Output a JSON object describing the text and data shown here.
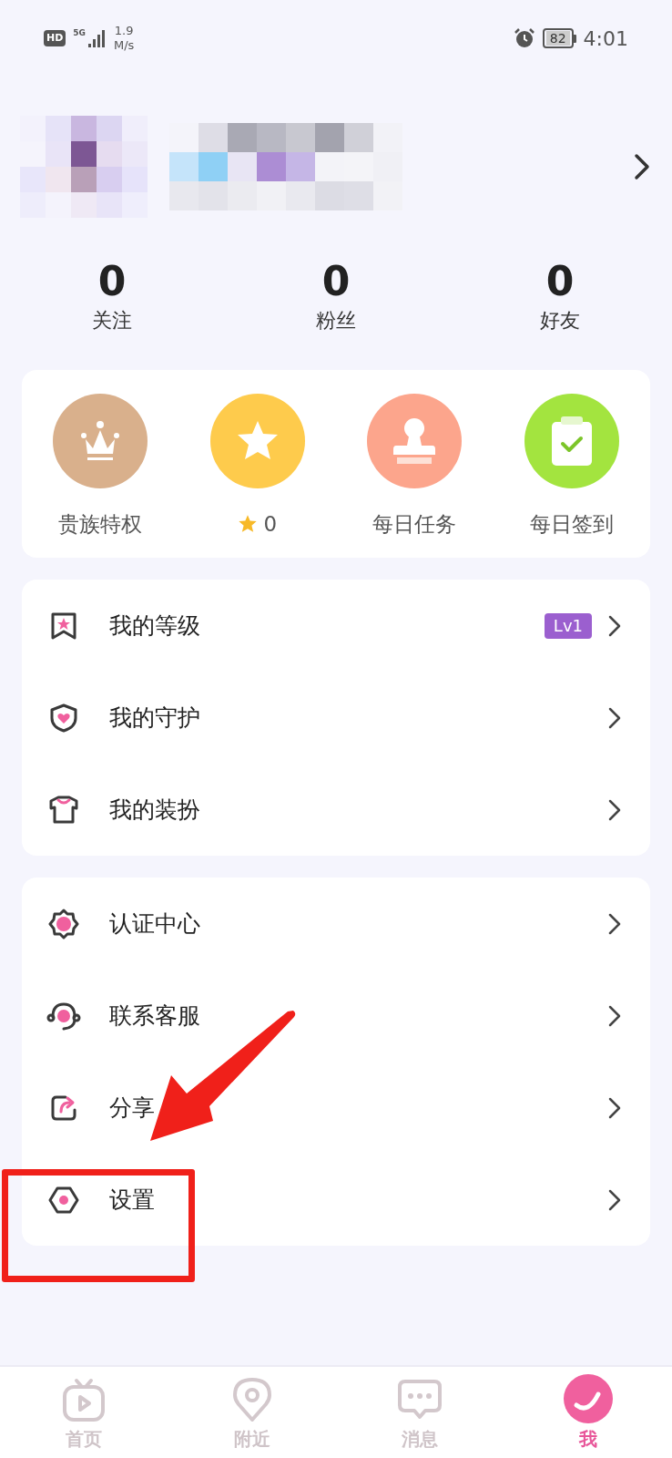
{
  "status_bar": {
    "hd": "HD",
    "network": "5G",
    "speed_value": "1.9",
    "speed_unit": "M/s",
    "battery": "82",
    "time": "4:01"
  },
  "stats": [
    {
      "value": "0",
      "label": "关注"
    },
    {
      "value": "0",
      "label": "粉丝"
    },
    {
      "value": "0",
      "label": "好友"
    }
  ],
  "quick_actions": [
    {
      "kind": "crown",
      "label": "贵族特权",
      "color": "#d9b08c"
    },
    {
      "kind": "star",
      "label": "0",
      "color": "#fecb4c"
    },
    {
      "kind": "stamp",
      "label": "每日任务",
      "color": "#fca58c"
    },
    {
      "kind": "clipboard",
      "label": "每日签到",
      "color": "#a3e43f"
    }
  ],
  "menu_groups": [
    [
      {
        "kind": "level",
        "label": "我的等级",
        "badge": "Lv1"
      },
      {
        "kind": "guard",
        "label": "我的守护"
      },
      {
        "kind": "outfit",
        "label": "我的装扮"
      }
    ],
    [
      {
        "kind": "verify",
        "label": "认证中心"
      },
      {
        "kind": "service",
        "label": "联系客服"
      },
      {
        "kind": "share",
        "label": "分享"
      },
      {
        "kind": "settings",
        "label": "设置"
      }
    ]
  ],
  "bottom_nav": [
    {
      "kind": "home",
      "label": "首页",
      "selected": false
    },
    {
      "kind": "nearby",
      "label": "附近",
      "selected": false
    },
    {
      "kind": "messages",
      "label": "消息",
      "selected": false
    },
    {
      "kind": "me",
      "label": "我",
      "selected": true
    }
  ]
}
